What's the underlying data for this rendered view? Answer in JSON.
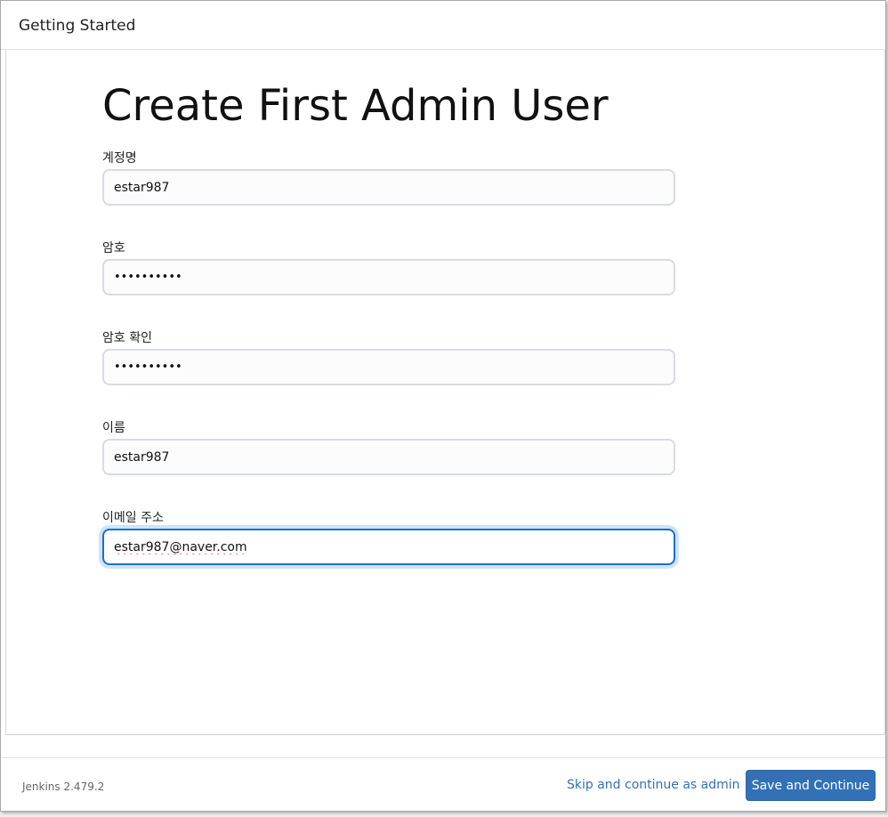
{
  "header": {
    "title": "Getting Started"
  },
  "main": {
    "title": "Create First Admin User",
    "fields": [
      {
        "label": "계정명",
        "value": "estar987",
        "type": "text"
      },
      {
        "label": "암호",
        "value": "••••••••••",
        "type": "password"
      },
      {
        "label": "암호 확인",
        "value": "••••••••••",
        "type": "password"
      },
      {
        "label": "이름",
        "value": "estar987",
        "type": "text"
      },
      {
        "label": "이메일 주소",
        "value": "estar987@naver.com",
        "type": "email",
        "focused": true
      }
    ]
  },
  "footer": {
    "version": "Jenkins 2.479.2",
    "skip_label": "Skip and continue as admin",
    "save_label": "Save and Continue"
  },
  "colors": {
    "primary_button": "#3271b5",
    "link": "#2e72b8",
    "focus_border": "#1a6fcc"
  }
}
